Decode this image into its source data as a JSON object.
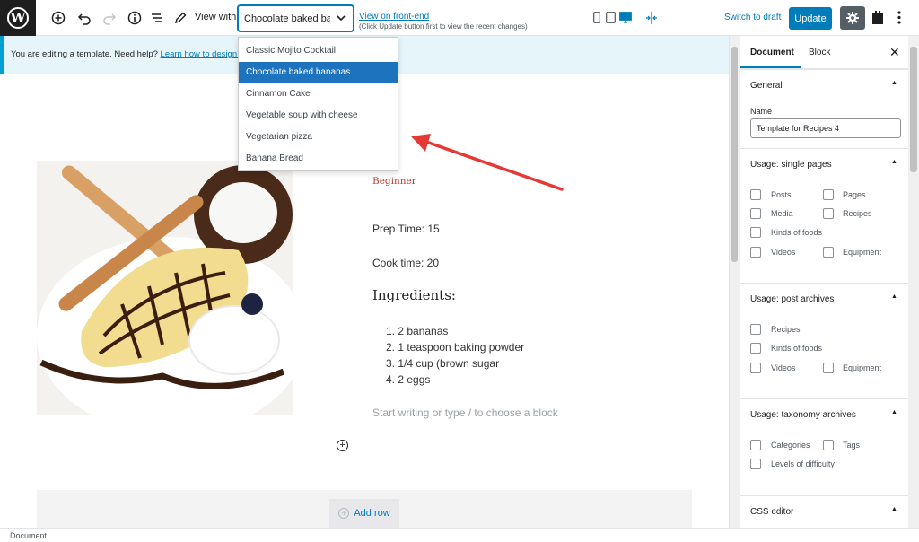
{
  "toolbar": {
    "view_with_label": "View with:",
    "selected_template": "Chocolate baked ban...",
    "front_link": "View on front-end",
    "front_note": "(Click Update button first to view the recent changes)",
    "switch_draft": "Switch to draft",
    "update": "Update"
  },
  "dropdown": {
    "options": [
      "Classic Mojito Cocktail",
      "Chocolate baked bananas",
      "Cinnamon Cake",
      "Vegetable soup with cheese",
      "Vegetarian pizza",
      "Banana Bread"
    ],
    "selected_index": 1
  },
  "notice": {
    "text": "You are editing a template. Need help? ",
    "link": "Learn how to design te"
  },
  "content": {
    "difficulty": "Beginner",
    "prep_time": "Prep Time: 15",
    "cook_time": "Cook time: 20",
    "ingredients_title": "Ingredients:",
    "ingredients": [
      "1. 2 bananas",
      "2. 1 teaspoon baking powder",
      "3. 1/4 cup (brown sugar",
      "4. 2 eggs"
    ],
    "placeholder": "Start writing or type / to choose a block",
    "add_row": "Add row"
  },
  "sidebar": {
    "tabs": [
      "Document",
      "Block"
    ],
    "general_title": "General",
    "name_label": "Name",
    "name_value": "Template for Recipes 4",
    "single_pages": {
      "title": "Usage: single pages",
      "options": [
        "Posts",
        "Pages",
        "Media",
        "Recipes",
        "Kinds of foods",
        "Videos",
        "Equipment"
      ]
    },
    "post_archives": {
      "title": "Usage: post archives",
      "options": [
        "Recipes",
        "Kinds of foods",
        "Videos",
        "Equipment"
      ]
    },
    "taxonomy_archives": {
      "title": "Usage: taxonomy archives",
      "options": [
        "Categories",
        "Tags",
        "Levels of difficulty"
      ]
    },
    "css_editor_title": "CSS editor"
  },
  "statusbar": {
    "text": "Document"
  },
  "colors": {
    "accent": "#007cba",
    "dropdown_selected": "#1e73be",
    "arrow": "#e53935",
    "difficulty": "#c0392b"
  }
}
